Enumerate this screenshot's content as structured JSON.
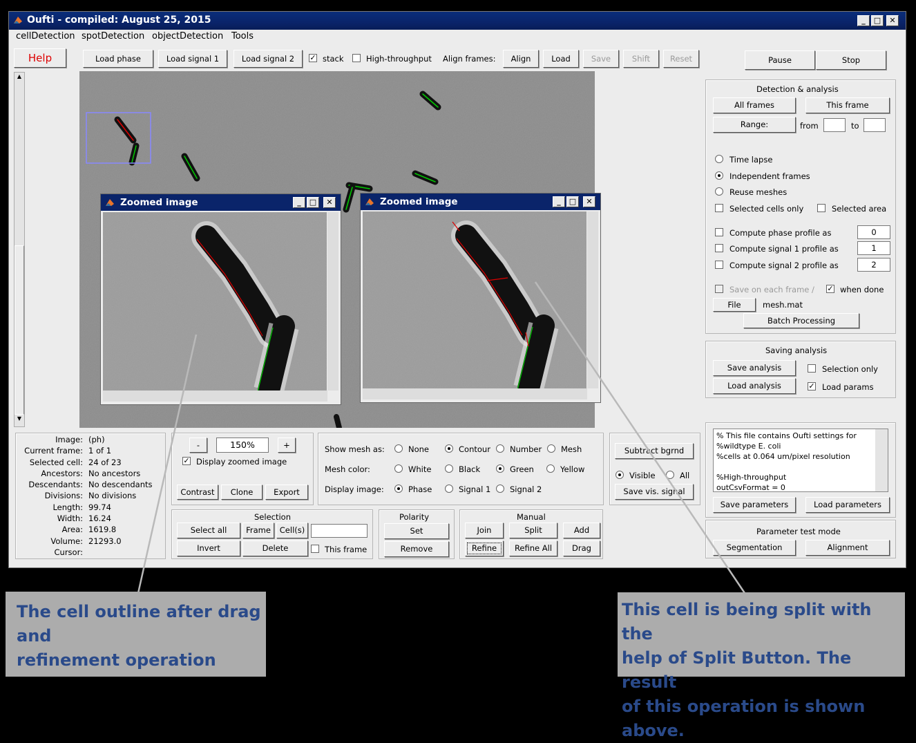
{
  "window": {
    "title": "Oufti - compiled:  August 25, 2015"
  },
  "menu": [
    "cellDetection",
    "spotDetection",
    "objectDetection",
    "Tools"
  ],
  "toolbar": {
    "help": "Help",
    "load_phase": "Load phase",
    "load_signal1": "Load signal 1",
    "load_signal2": "Load signal 2",
    "stack": "stack",
    "high_throughput": "High-throughput",
    "align_frames": "Align frames:",
    "align": "Align",
    "load": "Load",
    "save": "Save",
    "shift": "Shift",
    "reset": "Reset",
    "pause": "Pause",
    "stop": "Stop"
  },
  "zoom_windows": [
    {
      "title": "Zoomed image"
    },
    {
      "title": "Zoomed image"
    }
  ],
  "detection": {
    "title": "Detection & analysis",
    "all_frames": "All frames",
    "this_frame": "This frame",
    "range": "Range:",
    "from": "from",
    "to": "to",
    "time_lapse": "Time lapse",
    "independent_frames": "Independent frames",
    "reuse_meshes": "Reuse meshes",
    "selected_cells_only": "Selected cells only",
    "selected_area": "Selected area",
    "phase_profile": "Compute phase profile as",
    "phase_val": "0",
    "signal1_profile": "Compute signal 1 profile as",
    "signal1_val": "1",
    "signal2_profile": "Compute signal 2 profile as",
    "signal2_val": "2",
    "save_each_frame": "Save on each frame /",
    "when_done": "when done",
    "file": "File",
    "filename": "mesh.mat",
    "batch": "Batch Processing"
  },
  "saving": {
    "title": "Saving analysis",
    "save": "Save analysis",
    "selection_only": "Selection only",
    "load": "Load analysis",
    "load_params": "Load params"
  },
  "params_text": [
    "% This file contains Oufti settings for",
    "%wildtype E. coli",
    "%cells at 0.064 um/pixel resolution",
    "",
    "%High-throughput",
    "outCsvFormat = 0"
  ],
  "params": {
    "save": "Save parameters",
    "load": "Load parameters",
    "test_title": "Parameter test mode",
    "segmentation": "Segmentation",
    "alignment": "Alignment"
  },
  "info": {
    "labels": [
      "Image:",
      "Current frame:",
      "Selected cell:",
      "Ancestors:",
      "Descendants:",
      "Divisions:",
      "Length:",
      "Width:",
      "Area:",
      "Volume:",
      "Cursor:"
    ],
    "values": [
      "(ph)",
      "1 of 1",
      "24 of 23",
      "No ancestors",
      "No descendants",
      "No divisions",
      "99.74",
      "16.24",
      "1619.8",
      "21293.0",
      ""
    ]
  },
  "zoom": {
    "minus": "-",
    "value": "150%",
    "plus": "+",
    "display": "Display zoomed image",
    "contrast": "Contrast",
    "clone": "Clone",
    "export": "Export"
  },
  "display": {
    "show_mesh": "Show mesh as:",
    "none": "None",
    "contour": "Contour",
    "number": "Number",
    "mesh": "Mesh",
    "mesh_color": "Mesh color:",
    "white": "White",
    "black": "Black",
    "green": "Green",
    "yellow": "Yellow",
    "display_image": "Display image:",
    "phase": "Phase",
    "signal1": "Signal 1",
    "signal2": "Signal 2"
  },
  "bg": {
    "subtract": "Subtract bgrnd",
    "visible": "Visible",
    "all": "All",
    "save_vis": "Save vis. signal"
  },
  "selection": {
    "title": "Selection",
    "select_all": "Select all",
    "frame": "Frame",
    "cells": "Cell(s)",
    "invert": "Invert",
    "delete": "Delete",
    "this_frame": "This frame"
  },
  "polarity": {
    "title": "Polarity",
    "set": "Set",
    "remove": "Remove"
  },
  "manual": {
    "title": "Manual",
    "join": "Join",
    "split": "Split",
    "add": "Add",
    "refine": "Refine",
    "refine_all": "Refine All",
    "drag": "Drag"
  },
  "notes": {
    "left": [
      "The cell outline after drag and",
      "refinement operation"
    ],
    "right": [
      "This cell is being split with the",
      "help of Split Button.  The result",
      "of this operation is shown above."
    ]
  }
}
